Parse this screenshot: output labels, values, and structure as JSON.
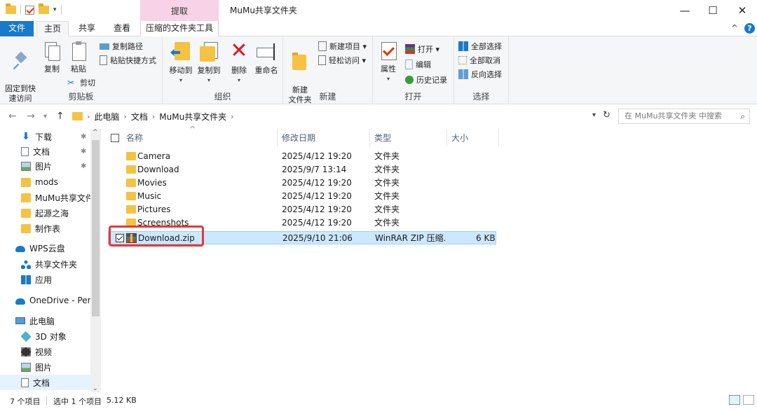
{
  "window": {
    "title": "MuMu共享文件夹",
    "context_tab": "提取",
    "minimize": "—",
    "maximize": "☐",
    "close": "✕"
  },
  "ribbon_tabs": {
    "file": "文件",
    "home": "主页",
    "share": "共享",
    "view": "查看",
    "tools": "压缩的文件夹工具",
    "collapse": "^",
    "help": "?"
  },
  "ribbon": {
    "clipboard": {
      "label": "剪贴板",
      "pin": "固定到快\n速访问",
      "copy": "复制",
      "paste": "粘贴",
      "copy_path": "复制路径",
      "paste_shortcut": "粘贴快捷方式",
      "cut": "剪切"
    },
    "organize": {
      "label": "组织",
      "move_to": "移动到",
      "copy_to": "复制到",
      "delete": "删除",
      "rename": "重命名"
    },
    "new": {
      "label": "新建",
      "new_folder": "新建\n文件夹",
      "new_item": "新建项目 ▾",
      "easy_access": "轻松访问 ▾"
    },
    "open": {
      "label": "打开",
      "properties": "属性",
      "open": "打开 ▾",
      "edit": "编辑",
      "history": "历史记录"
    },
    "select": {
      "label": "选择",
      "select_all": "全部选择",
      "select_none": "全部取消",
      "invert": "反向选择"
    }
  },
  "address": {
    "crumbs": [
      "此电脑",
      "文档",
      "MuMu共享文件夹"
    ],
    "search_placeholder": "在 MuMu共享文件夹 中搜索"
  },
  "sidebar": {
    "items": [
      {
        "label": "下载",
        "icon": "download-icon",
        "pinned": true
      },
      {
        "label": "文档",
        "icon": "document-icon",
        "pinned": true
      },
      {
        "label": "图片",
        "icon": "picture-icon",
        "pinned": true
      },
      {
        "label": "mods",
        "icon": "folder-icon",
        "pinned": false
      },
      {
        "label": "MuMu共享文件",
        "icon": "folder-icon",
        "pinned": false
      },
      {
        "label": "起源之海",
        "icon": "folder-icon",
        "pinned": false
      },
      {
        "label": "制作表",
        "icon": "folder-icon",
        "pinned": false
      },
      {
        "label": "WPS云盘",
        "icon": "cloud-icon",
        "pinned": false
      },
      {
        "label": "共享文件夹",
        "icon": "share-icon",
        "pinned": false
      },
      {
        "label": "应用",
        "icon": "apps-icon",
        "pinned": false
      },
      {
        "label": "OneDrive - Pers",
        "icon": "onedrive-icon",
        "pinned": false
      },
      {
        "label": "此电脑",
        "icon": "pc-icon",
        "pinned": false
      },
      {
        "label": "3D 对象",
        "icon": "3d-icon",
        "pinned": false
      },
      {
        "label": "视频",
        "icon": "video-icon",
        "pinned": false
      },
      {
        "label": "图片",
        "icon": "picture-icon",
        "pinned": false
      },
      {
        "label": "文档",
        "icon": "document-icon",
        "pinned": false
      }
    ]
  },
  "columns": {
    "name": "名称",
    "modified": "修改日期",
    "type": "类型",
    "size": "大小"
  },
  "files": [
    {
      "name": "Camera",
      "modified": "2025/4/12 19:20",
      "type": "文件夹",
      "size": ""
    },
    {
      "name": "Download",
      "modified": "2025/9/7 13:14",
      "type": "文件夹",
      "size": ""
    },
    {
      "name": "Movies",
      "modified": "2025/4/12 19:20",
      "type": "文件夹",
      "size": ""
    },
    {
      "name": "Music",
      "modified": "2025/4/12 19:20",
      "type": "文件夹",
      "size": ""
    },
    {
      "name": "Pictures",
      "modified": "2025/4/12 19:20",
      "type": "文件夹",
      "size": ""
    },
    {
      "name": "Screenshots",
      "modified": "2025/4/12 19:20",
      "type": "文件夹",
      "size": ""
    },
    {
      "name": "Download.zip",
      "modified": "2025/9/10 21:06",
      "type": "WinRAR ZIP 压缩...",
      "size": "6 KB"
    }
  ],
  "status": {
    "count": "7 个项目",
    "selected": "选中 1 个项目",
    "selected_size": "5.12 KB"
  }
}
